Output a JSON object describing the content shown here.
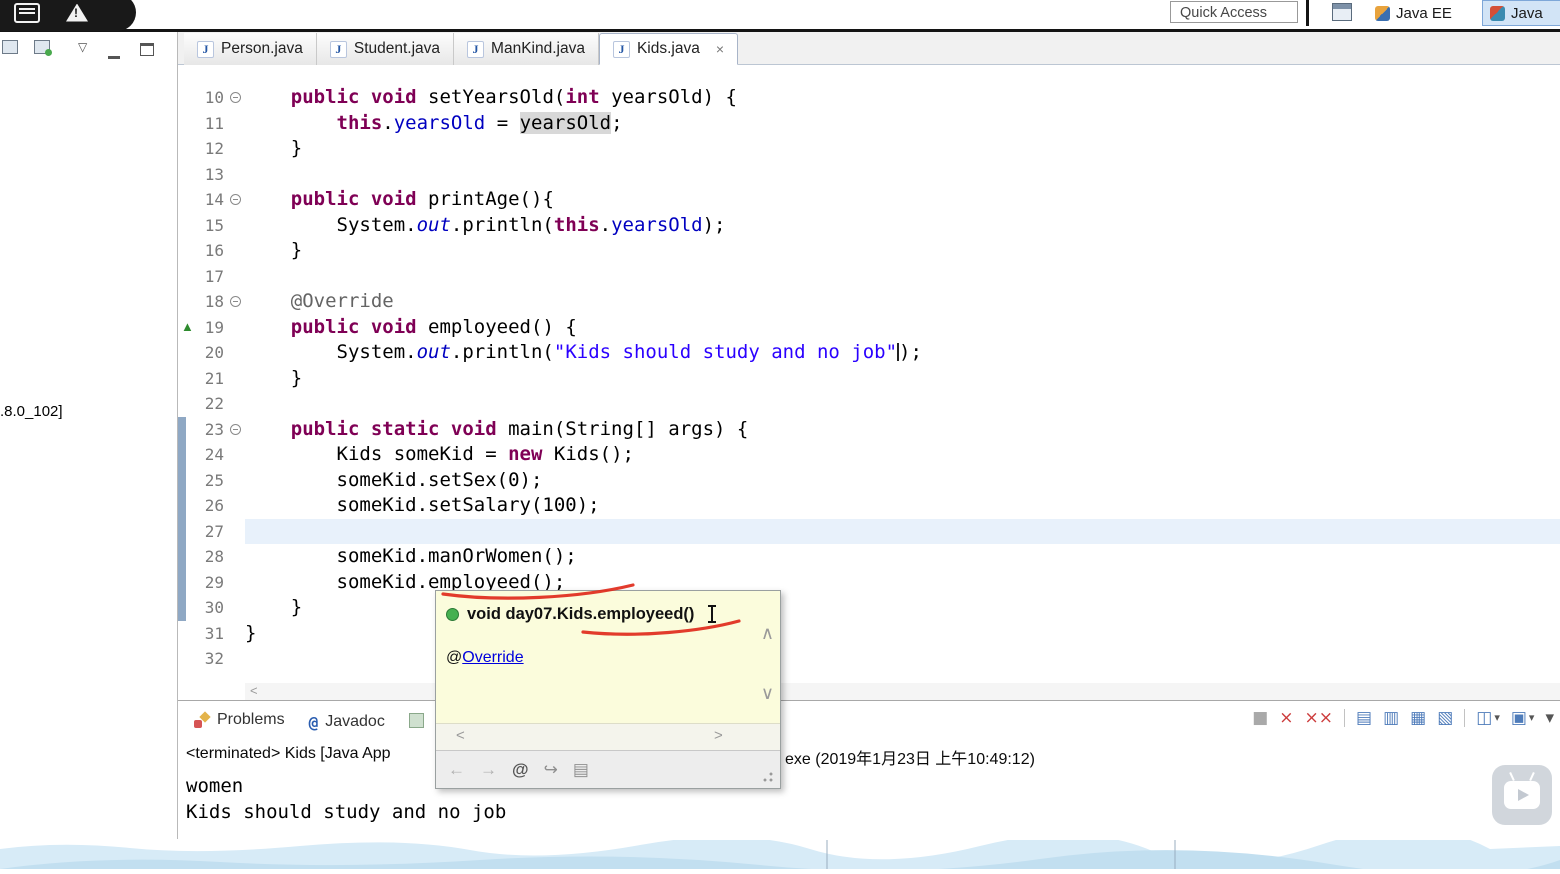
{
  "topbar": {
    "quick_access": "Quick Access",
    "java_ee_label": "Java EE",
    "java_label": "Java"
  },
  "explorer": {
    "jre_fragment": ".8.0_102]"
  },
  "icons": {
    "close": "×",
    "caret_down": "▾"
  },
  "editor_tabs": [
    {
      "label": "Person.java",
      "active": false
    },
    {
      "label": "Student.java",
      "active": false
    },
    {
      "label": "ManKind.java",
      "active": false
    },
    {
      "label": "Kids.java",
      "active": true
    }
  ],
  "editor": {
    "lines": [
      {
        "n": "10",
        "fold": true,
        "tokens": [
          [
            "    ",
            "p"
          ],
          [
            "public void",
            "k"
          ],
          [
            " setYearsOld(",
            "p"
          ],
          [
            "int",
            "k"
          ],
          [
            " yearsOld) {",
            "p"
          ]
        ]
      },
      {
        "n": "11",
        "tokens": [
          [
            "        ",
            "p"
          ],
          [
            "this",
            "k"
          ],
          [
            ".",
            "p"
          ],
          [
            "yearsOld",
            "f"
          ],
          [
            " = ",
            "p"
          ],
          [
            "yearsOld",
            "occ"
          ],
          [
            ";",
            "p"
          ]
        ]
      },
      {
        "n": "12",
        "tokens": [
          [
            "    }",
            "p"
          ]
        ]
      },
      {
        "n": "13",
        "tokens": []
      },
      {
        "n": "14",
        "fold": true,
        "tokens": [
          [
            "    ",
            "p"
          ],
          [
            "public void",
            "k"
          ],
          [
            " printAge(){",
            "p"
          ]
        ]
      },
      {
        "n": "15",
        "tokens": [
          [
            "        System.",
            "p"
          ],
          [
            "out",
            "sf"
          ],
          [
            ".println(",
            "p"
          ],
          [
            "this",
            "k"
          ],
          [
            ".",
            "p"
          ],
          [
            "yearsOld",
            "f"
          ],
          [
            ");",
            "p"
          ]
        ]
      },
      {
        "n": "16",
        "tokens": [
          [
            "    }",
            "p"
          ]
        ]
      },
      {
        "n": "17",
        "tokens": []
      },
      {
        "n": "18",
        "fold": true,
        "tokens": [
          [
            "    @Override",
            "a"
          ]
        ]
      },
      {
        "n": "19",
        "mark": "override",
        "tokens": [
          [
            "    ",
            "p"
          ],
          [
            "public void",
            "k"
          ],
          [
            " employeed() {",
            "p"
          ]
        ]
      },
      {
        "n": "20",
        "tokens": [
          [
            "        System.",
            "p"
          ],
          [
            "out",
            "sf"
          ],
          [
            ".println(",
            "p"
          ],
          [
            "\"Kids should study and no job\"",
            "s"
          ],
          [
            "",
            "caret"
          ],
          [
            ");",
            "p"
          ]
        ]
      },
      {
        "n": "21",
        "tokens": [
          [
            "    }",
            "p"
          ]
        ]
      },
      {
        "n": "22",
        "tokens": []
      },
      {
        "n": "23",
        "fold": true,
        "changed": true,
        "tokens": [
          [
            "    ",
            "p"
          ],
          [
            "public static void",
            "k"
          ],
          [
            " main(String[] args) {",
            "p"
          ]
        ]
      },
      {
        "n": "24",
        "changed": true,
        "tokens": [
          [
            "        Kids someKid = ",
            "p"
          ],
          [
            "new",
            "k"
          ],
          [
            " Kids();",
            "p"
          ]
        ]
      },
      {
        "n": "25",
        "changed": true,
        "tokens": [
          [
            "        someKid.setSex(0);",
            "p"
          ]
        ]
      },
      {
        "n": "26",
        "changed": true,
        "tokens": [
          [
            "        someKid.setSalary(100);",
            "p"
          ]
        ]
      },
      {
        "n": "27",
        "changed": true,
        "hl": true,
        "tokens": []
      },
      {
        "n": "28",
        "changed": true,
        "tokens": [
          [
            "        someKid.manOrWomen();",
            "p"
          ]
        ]
      },
      {
        "n": "29",
        "changed": true,
        "tokens": [
          [
            "        someKid.employeed();",
            "p"
          ]
        ]
      },
      {
        "n": "30",
        "changed": true,
        "tokens": [
          [
            "    }",
            "p"
          ]
        ]
      },
      {
        "n": "31",
        "tokens": [
          [
            "}",
            "p"
          ]
        ]
      },
      {
        "n": "32",
        "tokens": []
      }
    ],
    "hscroll_left_arrow": "<"
  },
  "popup": {
    "sig_pre": "void day07.",
    "sig_emph": "Kids.employeed",
    "sig_post": "()",
    "override_at": "@",
    "override_link": "Override",
    "icons": {
      "up": "∧",
      "down": "∨",
      "left": "<",
      "right": ">"
    },
    "footer": [
      {
        "name": "back-icon",
        "glyph": "←",
        "color": "#b0b0b0"
      },
      {
        "name": "forward-icon",
        "glyph": "→",
        "color": "#b0b0b0"
      },
      {
        "name": "show-javadoc-icon",
        "glyph": "@",
        "color": "#555555",
        "bold": true
      },
      {
        "name": "open-declaration-icon",
        "glyph": "↪",
        "color": "#8f8f8f"
      },
      {
        "name": "open-in-view-icon",
        "glyph": "▤",
        "color": "#8f8f8f"
      }
    ]
  },
  "console": {
    "tabs": [
      {
        "label": "Problems",
        "icon": "problems"
      },
      {
        "label": "Javadoc",
        "icon": "at"
      },
      {
        "label": "",
        "icon": "declaration"
      }
    ],
    "toolbar": [
      {
        "name": "terminate-icon",
        "glyph": "■",
        "color": "#a9a9a9"
      },
      {
        "name": "remove-launch-icon",
        "glyph": "×",
        "color": "#cc3b3b"
      },
      {
        "name": "remove-all-launches-icon",
        "glyph": "××",
        "color": "#cc3b3b"
      },
      {
        "sep": true
      },
      {
        "name": "clear-console-icon",
        "glyph": "▤",
        "color": "#4f7cba"
      },
      {
        "name": "scroll-lock-icon",
        "glyph": "▥",
        "color": "#4f7cba"
      },
      {
        "name": "word-wrap-icon",
        "glyph": "▦",
        "color": "#4f7cba"
      },
      {
        "name": "pin-console-icon",
        "glyph": "▧",
        "color": "#4f7cba"
      },
      {
        "sep": true
      },
      {
        "name": "display-console-icon",
        "glyph": "◫",
        "color": "#4f7cba",
        "caret": true
      },
      {
        "name": "open-console-icon",
        "glyph": "▣",
        "color": "#4f7cba",
        "caret": true
      },
      {
        "name": "view-menu-icon",
        "glyph": "▾",
        "color": "#555555"
      }
    ],
    "title_left": "<terminated> Kids [Java App",
    "title_right": "exe (2019年1月23日 上午10:49:12)",
    "output": [
      "women",
      "Kids should study and no job"
    ]
  }
}
